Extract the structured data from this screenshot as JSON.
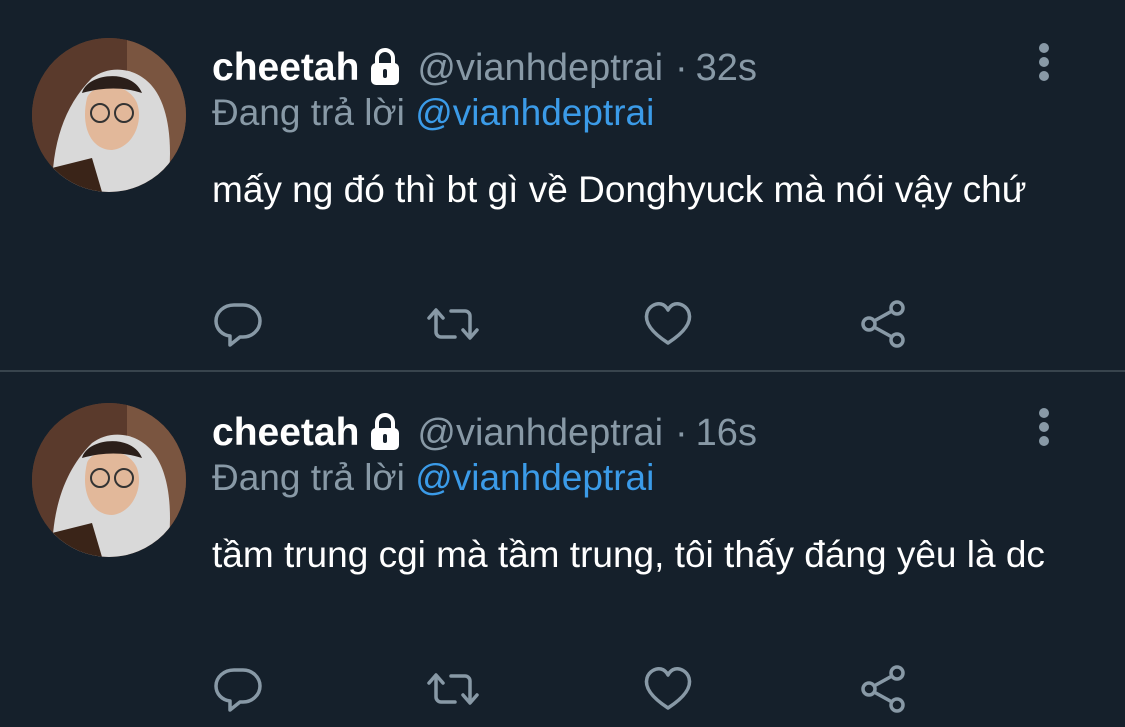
{
  "tweets": [
    {
      "name": "cheetah",
      "handle": "@vianhdeptrai",
      "separator": "·",
      "time": "32s",
      "replying_prefix": "Đang trả lời",
      "replying_to": "@vianhdeptrai",
      "text": "mấy ng đó thì bt gì về Donghyuck mà nói vậy chứ"
    },
    {
      "name": "cheetah",
      "handle": "@vianhdeptrai",
      "separator": "·",
      "time": "16s",
      "replying_prefix": "Đang trả lời",
      "replying_to": "@vianhdeptrai",
      "text": "tầm trung cgi mà tầm trung, tôi thấy đáng yêu là dc"
    }
  ],
  "icons": {
    "reply": "reply-icon",
    "retweet": "retweet-icon",
    "like": "heart-icon",
    "share": "share-icon",
    "more": "more-vertical-icon",
    "lock": "lock-icon"
  },
  "colors": {
    "background": "#15202b",
    "muted": "#8899a6",
    "link": "#3b9be8",
    "divider": "#38444d"
  }
}
